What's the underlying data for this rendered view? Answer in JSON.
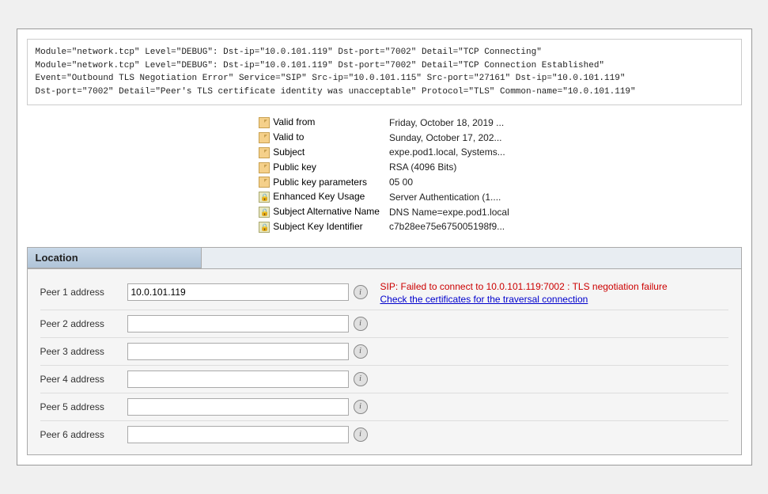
{
  "log": {
    "lines": [
      "Module=\"network.tcp\" Level=\"DEBUG\":  Dst-ip=\"10.0.101.119\" Dst-port=\"7002\" Detail=\"TCP Connecting\"",
      "Module=\"network.tcp\" Level=\"DEBUG\":  Dst-ip=\"10.0.101.119\" Dst-port=\"7002\" Detail=\"TCP Connection Established\"",
      "Event=\"Outbound TLS Negotiation Error\" Service=\"SIP\" Src-ip=\"10.0.101.115\" Src-port=\"27161\" Dst-ip=\"10.0.101.119\"",
      "    Dst-port=\"7002\" Detail=\"Peer's TLS certificate identity was unacceptable\" Protocol=\"TLS\" Common-name=\"10.0.101.119\""
    ]
  },
  "cert_fields": [
    {
      "icon": "doc",
      "label": "Valid from",
      "value": "Friday, October 18, 2019 ..."
    },
    {
      "icon": "doc",
      "label": "Valid to",
      "value": "Sunday, October 17, 202..."
    },
    {
      "icon": "doc",
      "label": "Subject",
      "value": "expe.pod1.local, Systems..."
    },
    {
      "icon": "doc",
      "label": "Public key",
      "value": "RSA (4096 Bits)"
    },
    {
      "icon": "doc",
      "label": "Public key parameters",
      "value": "05 00"
    },
    {
      "icon": "cert",
      "label": "Enhanced Key Usage",
      "value": "Server Authentication (1...."
    },
    {
      "icon": "cert",
      "label": "Subject Alternative Name",
      "value": "DNS Name=expe.pod1.local"
    },
    {
      "icon": "cert",
      "label": "Subject Key Identifier",
      "value": "c7b28ee75e675005198f9..."
    }
  ],
  "location": {
    "title": "Location",
    "peers": [
      {
        "label": "Peer 1 address",
        "value": "10.0.101.119",
        "has_error": true
      },
      {
        "label": "Peer 2 address",
        "value": "",
        "has_error": false
      },
      {
        "label": "Peer 3 address",
        "value": "",
        "has_error": false
      },
      {
        "label": "Peer 4 address",
        "value": "",
        "has_error": false
      },
      {
        "label": "Peer 5 address",
        "value": "",
        "has_error": false
      },
      {
        "label": "Peer 6 address",
        "value": "",
        "has_error": false
      }
    ],
    "error_text": "SIP: Failed to connect to 10.0.101.119:7002 : TLS negotiation failure",
    "error_link": "Check the certificates for the traversal connection"
  }
}
